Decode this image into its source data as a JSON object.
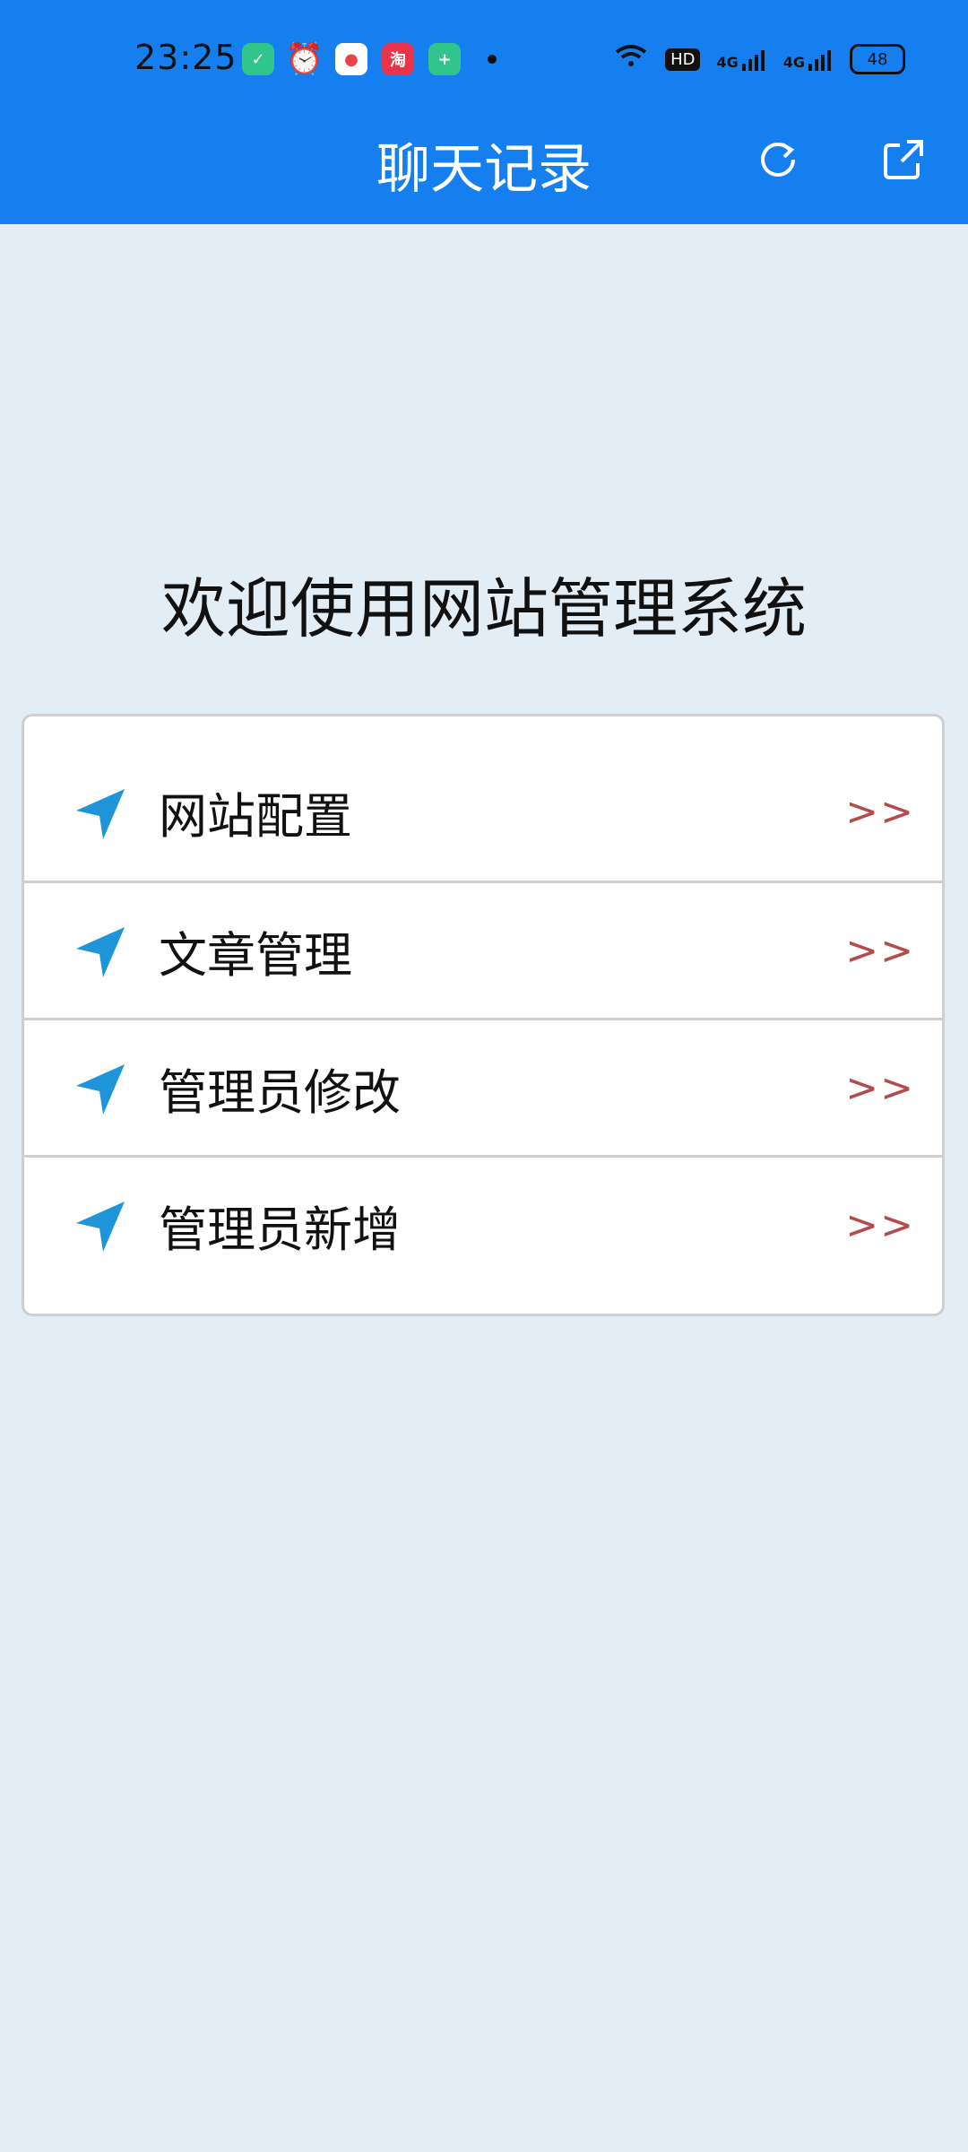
{
  "status": {
    "time": "23:25",
    "battery": "48",
    "hd_badge": "HD",
    "network_1": "4G",
    "network_2": "4G"
  },
  "header": {
    "title": "聊天记录",
    "refresh_icon": "refresh-icon",
    "share_icon": "share-icon"
  },
  "welcome": "欢迎使用网站管理系统",
  "menu": {
    "items": [
      {
        "label": "网站配置",
        "arrow": ">>"
      },
      {
        "label": "文章管理",
        "arrow": ">>"
      },
      {
        "label": "管理员修改",
        "arrow": ">>"
      },
      {
        "label": "管理员新增",
        "arrow": ">>"
      }
    ]
  },
  "colors": {
    "header_bg": "#157ff0",
    "page_bg": "#e3edf6",
    "icon_blue": "#1d95d8",
    "arrow_red": "#b34c4c"
  }
}
